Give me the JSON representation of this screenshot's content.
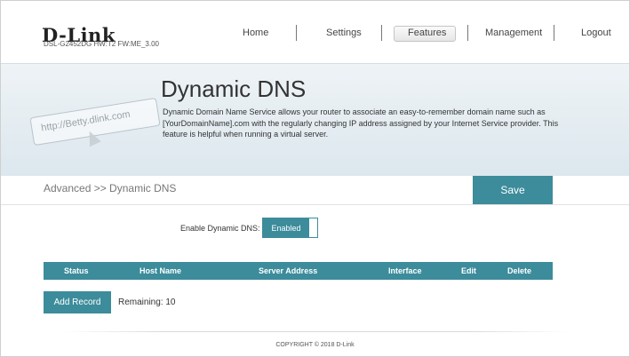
{
  "header": {
    "logo": "D-Link",
    "model_info": "DSL-G2452DG  HW:T2  FW:ME_3.00",
    "nav": [
      "Home",
      "Settings",
      "Features",
      "Management",
      "Logout"
    ],
    "active_nav": "Features"
  },
  "banner": {
    "title": "Dynamic DNS",
    "description": "Dynamic Domain Name Service allows your router to associate an easy-to-remember domain name such as [YourDomainName].com with the regularly changing IP address assigned by your Internet Service provider. This feature is helpful when running a virtual server.",
    "illustration_text": "http://Betty.dlink.com"
  },
  "breadcrumb": "Advanced >> Dynamic DNS",
  "save_label": "Save",
  "enable": {
    "label": "Enable Dynamic DNS:",
    "state": "Enabled"
  },
  "table": {
    "columns": [
      "Status",
      "Host Name",
      "Server Address",
      "Interface",
      "Edit",
      "Delete"
    ],
    "rows": []
  },
  "add_record_label": "Add Record",
  "remaining": "Remaining: 10",
  "copyright": "COPYRIGHT © 2018 D-Link",
  "colors": {
    "accent": "#3c8c9b",
    "banner": "#e3ecf1"
  }
}
